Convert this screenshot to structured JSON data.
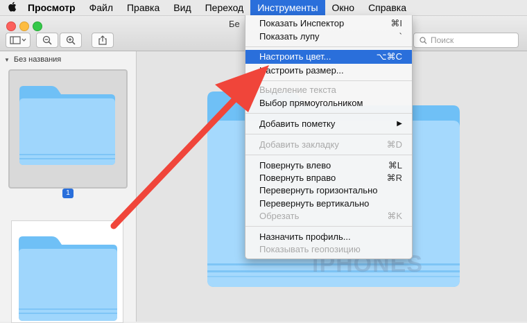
{
  "menubar": {
    "apple": "",
    "items": [
      {
        "label": "Просмотр"
      },
      {
        "label": "Файл"
      },
      {
        "label": "Правка"
      },
      {
        "label": "Вид"
      },
      {
        "label": "Переход"
      },
      {
        "label": "Инструменты"
      },
      {
        "label": "Окно"
      },
      {
        "label": "Справка"
      }
    ]
  },
  "window": {
    "title_partial": "Бе"
  },
  "toolbar": {
    "search_placeholder": "Поиск"
  },
  "sidebar": {
    "section_title": "Без названия",
    "page_badge": "1"
  },
  "menu": {
    "items": [
      {
        "label": "Показать Инспектор",
        "shortcut": "⌘I",
        "state": "normal"
      },
      {
        "label": "Показать лупу",
        "shortcut": "`",
        "state": "normal"
      },
      {
        "label": "Настроить цвет...",
        "shortcut": "⌥⌘C",
        "state": "highlighted"
      },
      {
        "label": "Настроить размер...",
        "shortcut": "",
        "state": "normal"
      },
      {
        "label": "Выделение текста",
        "shortcut": "",
        "state": "disabled"
      },
      {
        "label": "Выбор прямоугольником",
        "shortcut": "",
        "state": "normal"
      },
      {
        "label": "Добавить пометку",
        "shortcut": "",
        "state": "submenu"
      },
      {
        "label": "Добавить закладку",
        "shortcut": "⌘D",
        "state": "disabled"
      },
      {
        "label": "Повернуть влево",
        "shortcut": "⌘L",
        "state": "normal"
      },
      {
        "label": "Повернуть вправо",
        "shortcut": "⌘R",
        "state": "normal"
      },
      {
        "label": "Перевернуть горизонтально",
        "shortcut": "",
        "state": "normal"
      },
      {
        "label": "Перевернуть вертикально",
        "shortcut": "",
        "state": "normal"
      },
      {
        "label": "Обрезать",
        "shortcut": "⌘K",
        "state": "disabled"
      },
      {
        "label": "Назначить профиль...",
        "shortcut": "",
        "state": "normal"
      },
      {
        "label": "Показывать геопозицию",
        "shortcut": "",
        "state": "disabled"
      }
    ]
  },
  "watermark": "iPHONES",
  "colors": {
    "accent": "#2a6fdb",
    "arrow": "#f0453a",
    "folder_light": "#a8dcff",
    "folder_dark": "#62b8f4"
  }
}
